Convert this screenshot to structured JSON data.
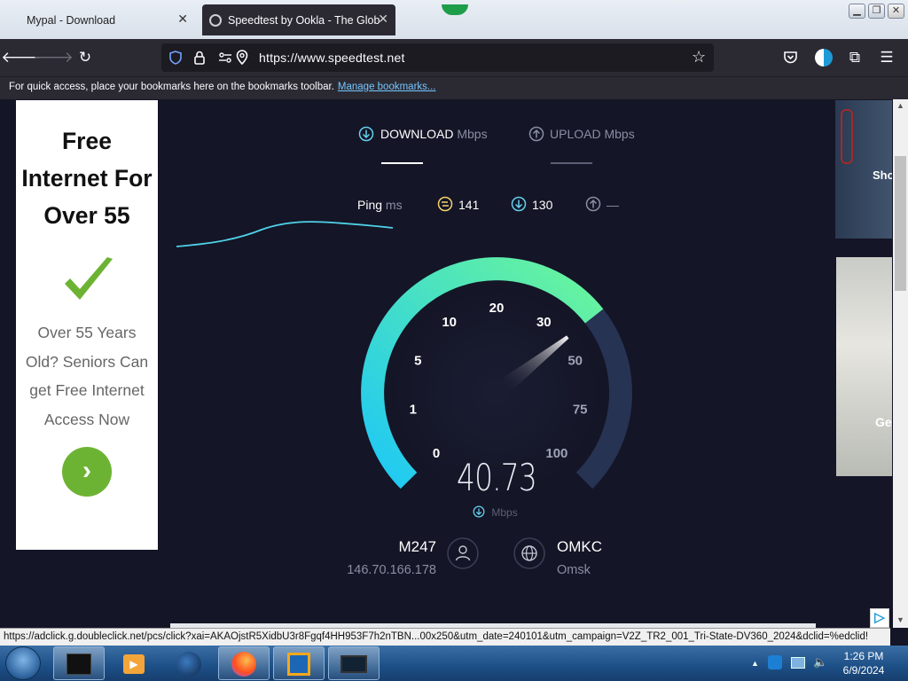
{
  "browser": {
    "tabs": [
      {
        "title": "Mypal - Download"
      },
      {
        "title": "Speedtest by Ookla - The Global Broadband Speed Test"
      }
    ],
    "url": "https://www.speedtest.net",
    "bookmarks_bar": {
      "message": "For quick access, place your bookmarks here on the bookmarks toolbar.",
      "link": "Manage bookmarks..."
    }
  },
  "ad": {
    "title_lines": [
      "Free",
      "Internet For",
      "Over 55"
    ],
    "body_lines": [
      "Over 55 Years",
      "Old? Seniors Can",
      "get Free Internet",
      "Access Now"
    ],
    "accent": "#6cb333"
  },
  "speedtest": {
    "download_label": "DOWNLOAD",
    "upload_label": "UPLOAD",
    "unit": "Mbps",
    "ping_label": "Ping",
    "ping_unit": "ms",
    "jitter": "141",
    "download_ping": "130",
    "upload_ping": "—",
    "gauge_labels": [
      "0",
      "1",
      "5",
      "10",
      "20",
      "30",
      "50",
      "75",
      "100"
    ],
    "current_speed": "40.73",
    "speed_unit": "Mbps",
    "isp": "M247",
    "ip": "146.70.166.178",
    "server": "OMKC",
    "server_city": "Omsk",
    "colors": {
      "gauge_start": "#1ec8f5",
      "gauge_end": "#6af59a",
      "track": "#263353"
    }
  },
  "right_ads": {
    "label_top": "Sho",
    "label_bottom": "Ge"
  },
  "status_url": "https://adclick.g.doubleclick.net/pcs/click?xai=AKAOjstR5XidbU3r8Fgqf4HH953F7h2nTBN...00x250&utm_date=240101&utm_campaign=V2Z_TR2_001_Tri-State-DV360_2024&dclid=%edclid!",
  "taskbar": {
    "time": "1:26 PM",
    "date": "6/9/2024"
  }
}
